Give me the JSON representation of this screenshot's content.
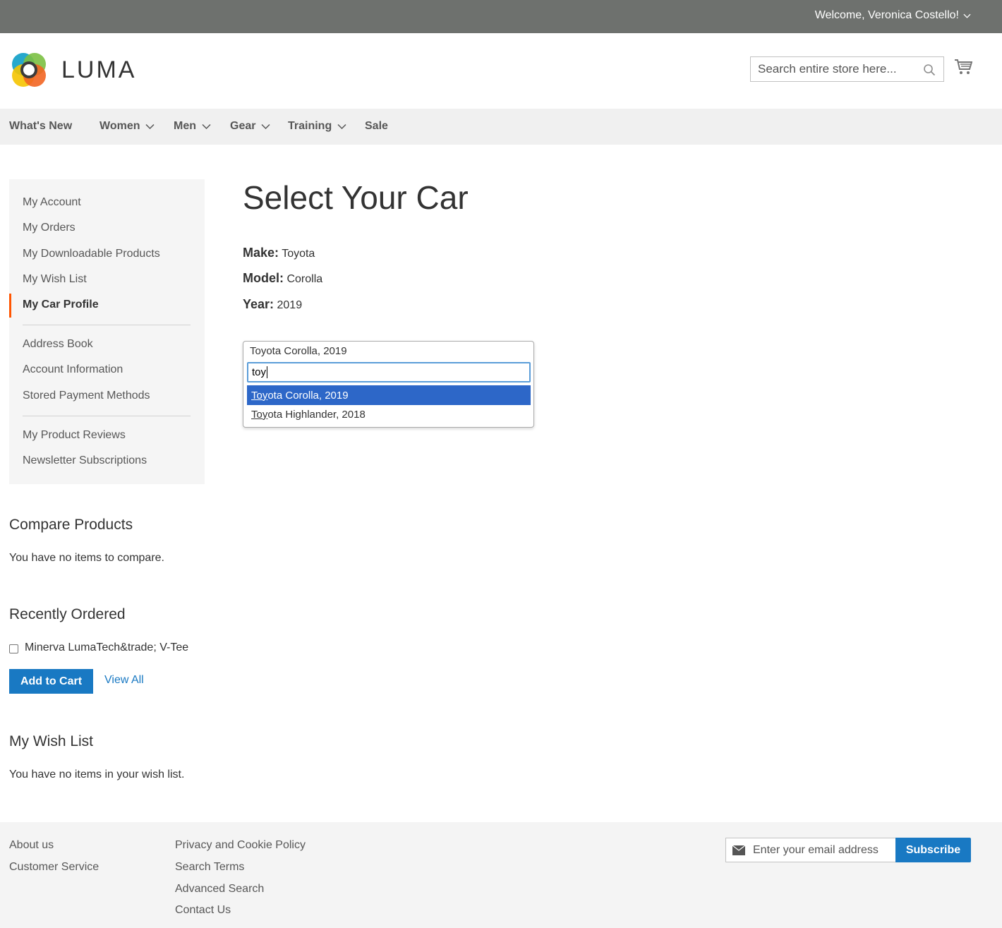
{
  "topbar": {
    "welcome": "Welcome, Veronica Costello!"
  },
  "header": {
    "logo_text": "LUMA",
    "search_placeholder": "Search entire store here..."
  },
  "nav": {
    "items": [
      {
        "label": "What's New"
      },
      {
        "label": "Women"
      },
      {
        "label": "Men"
      },
      {
        "label": "Gear"
      },
      {
        "label": "Training"
      },
      {
        "label": "Sale"
      }
    ]
  },
  "sidebar": {
    "items": [
      {
        "label": "My Account"
      },
      {
        "label": "My Orders"
      },
      {
        "label": "My Downloadable Products"
      },
      {
        "label": "My Wish List"
      },
      {
        "label": "My Car Profile"
      },
      {
        "label": "Address Book"
      },
      {
        "label": "Account Information"
      },
      {
        "label": "Stored Payment Methods"
      },
      {
        "label": "My Product Reviews"
      },
      {
        "label": "Newsletter Subscriptions"
      }
    ],
    "active": "My Car Profile"
  },
  "compare": {
    "title": "Compare Products",
    "empty": "You have no items to compare."
  },
  "recently_ordered": {
    "title": "Recently Ordered",
    "item": "Minerva LumaTech&trade; V-Tee",
    "add_to_cart": "Add to Cart",
    "view_all": "View All"
  },
  "wishlist": {
    "title": "My Wish List",
    "empty": "You have no items in your wish list."
  },
  "main": {
    "title": "Select Your Car",
    "make_label": "Make:",
    "make_value": "Toyota",
    "model_label": "Model:",
    "model_value": "Corolla",
    "year_label": "Year:",
    "year_value": "2019"
  },
  "combo": {
    "selected": "Toyota Corolla, 2019",
    "search_value": "toy",
    "options": [
      {
        "match": "Toy",
        "rest": "ota Corolla, 2019",
        "highlighted": true
      },
      {
        "match": "Toy",
        "rest": "ota Highlander, 2018",
        "highlighted": false
      }
    ]
  },
  "footer": {
    "col1": [
      "About us",
      "Customer Service"
    ],
    "col2": [
      "Privacy and Cookie Policy",
      "Search Terms",
      "Advanced Search",
      "Contact Us"
    ],
    "newsletter_placeholder": "Enter your email address",
    "subscribe": "Subscribe"
  },
  "colors": {
    "accent": "#1979c3",
    "active_bar": "#ff5501",
    "highlight": "#2d67c8",
    "topbar": "#6e716e"
  }
}
